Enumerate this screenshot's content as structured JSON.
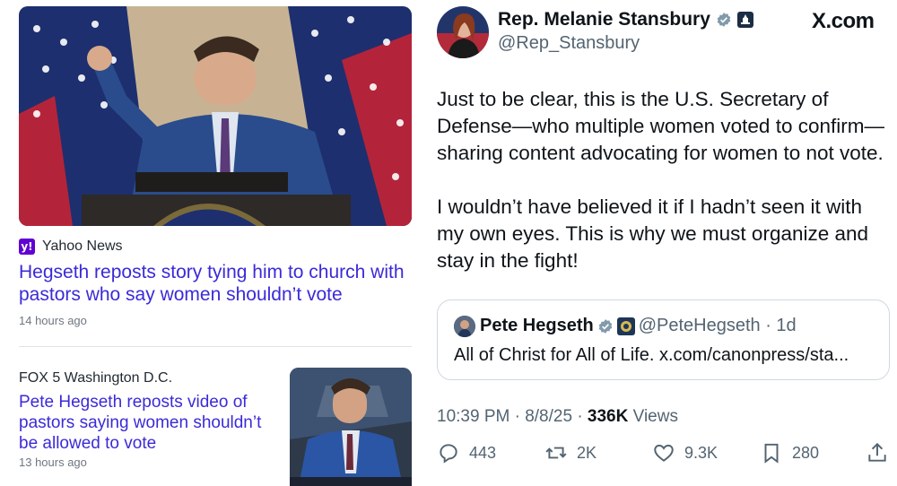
{
  "left": {
    "article1": {
      "source": "Yahoo News",
      "source_icon": "yahoo-y-logo",
      "source_icon_text": "y!",
      "headline": "Hegseth reposts story tying him to church with pastors who say women shouldn’t vote",
      "time": "14 hours ago"
    },
    "article2": {
      "source": "FOX 5 Washington D.C.",
      "headline": "Pete Hegseth reposts video of pastors saying women shouldn’t be allowed to vote",
      "time": "13 hours ago"
    }
  },
  "tweet": {
    "display_name": "Rep. Melanie Stansbury",
    "handle": "@Rep_Stansbury",
    "site": "X.com",
    "paragraph1": "Just to be clear, this is the U.S. Secretary of Defense—who multiple women voted to confirm—sharing content advocating for women to not vote.",
    "paragraph2": "I wouldn’t have believed it if I hadn’t seen it with my own eyes. This is why we must organize and stay in the fight!",
    "quote": {
      "name": "Pete Hegseth",
      "handle_time": "@PeteHegseth · 1d",
      "text": "All of Christ for All of Life. x.com/canonpress/sta..."
    },
    "timestamp": "10:39 PM · 8/8/25 · ",
    "views_count": "336K",
    "views_label": " Views",
    "actions": {
      "replies": "443",
      "reposts": "2K",
      "likes": "9.3K",
      "bookmarks": "280"
    }
  },
  "colors": {
    "headline": "#3b2ad8",
    "verified": "#829aab",
    "yahoo": "#6001d2"
  }
}
